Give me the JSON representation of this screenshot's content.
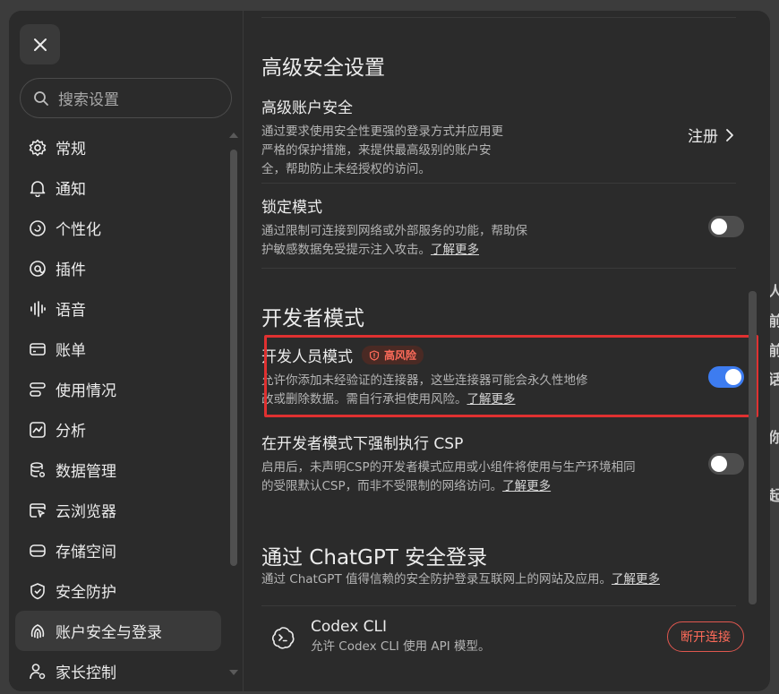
{
  "backdrop": {
    "glyphs": [
      "人",
      "前",
      "前",
      "话",
      "你",
      "起"
    ]
  },
  "search": {
    "placeholder": "搜索设置"
  },
  "sidebar": {
    "items": [
      {
        "label": "常规",
        "icon": "gear-icon"
      },
      {
        "label": "通知",
        "icon": "bell-icon"
      },
      {
        "label": "个性化",
        "icon": "personalize-icon"
      },
      {
        "label": "插件",
        "icon": "plugin-icon"
      },
      {
        "label": "语音",
        "icon": "voice-icon"
      },
      {
        "label": "账单",
        "icon": "billing-icon"
      },
      {
        "label": "使用情况",
        "icon": "usage-icon"
      },
      {
        "label": "分析",
        "icon": "analytics-icon"
      },
      {
        "label": "数据管理",
        "icon": "data-icon"
      },
      {
        "label": "云浏览器",
        "icon": "cloud-browser-icon"
      },
      {
        "label": "存储空间",
        "icon": "storage-icon"
      },
      {
        "label": "安全防护",
        "icon": "shield-icon"
      },
      {
        "label": "账户安全与登录",
        "icon": "fingerprint-icon",
        "active": true
      },
      {
        "label": "家长控制",
        "icon": "parental-icon"
      }
    ]
  },
  "advanced": {
    "title": "高级安全设置",
    "account_security": {
      "title": "高级账户安全",
      "desc": "通过要求使用安全性更强的登录方式并应用更严格的保护措施，来提供最高级别的账户安全，帮助防止未经授权的访问。",
      "action": "注册"
    },
    "lockdown": {
      "title": "锁定模式",
      "desc": "通过限制可连接到网络或外部服务的功能，帮助保护敏感数据免受提示注入攻击。",
      "link": "了解更多",
      "enabled": false
    }
  },
  "developer": {
    "title": "开发者模式",
    "dev_mode": {
      "title": "开发人员模式",
      "badge": "高风险",
      "desc": "允许你添加未经验证的连接器，这些连接器可能会永久性地修改或删除数据。需自行承担使用风险。",
      "link": "了解更多",
      "enabled": true
    },
    "csp": {
      "title": "在开发者模式下强制执行 CSP",
      "desc": "启用后，未声明CSP的开发者模式应用或小组件将使用与生产环境相同的受限默认CSP，而非不受限制的网络访问。",
      "link": "了解更多",
      "enabled": false
    }
  },
  "chatgpt_login": {
    "title": "通过 ChatGPT 安全登录",
    "desc": "通过 ChatGPT 值得信赖的安全防护登录互联网上的网站及应用。",
    "link": "了解更多",
    "app": {
      "name": "Codex CLI",
      "desc": "允许 Codex CLI 使用 API 模型。",
      "action": "断开连接"
    }
  },
  "colors": {
    "accent": "#3d7cf0",
    "danger": "#e03131"
  }
}
